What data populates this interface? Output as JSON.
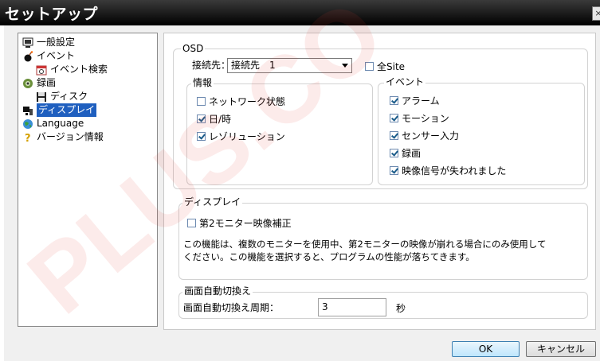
{
  "window": {
    "title": "セットアップ",
    "close_glyph": "×"
  },
  "tree": {
    "items": [
      {
        "label": "一般設定",
        "icon": "monitor-icon",
        "selected": false
      },
      {
        "label": "イベント",
        "icon": "bomb-icon",
        "selected": false
      },
      {
        "label": "イベント検索",
        "icon": "calendar-search-icon",
        "selected": false
      },
      {
        "label": "録画",
        "icon": "camera-icon",
        "selected": false
      },
      {
        "label": "ディスク",
        "icon": "floppy-disk-icon",
        "selected": false
      },
      {
        "label": "ディスプレイ",
        "icon": "display-icon",
        "selected": true
      },
      {
        "label": "Language",
        "icon": "globe-icon",
        "selected": false
      },
      {
        "label": "バージョン情報",
        "icon": "question-mark-icon",
        "selected": false
      }
    ]
  },
  "osd": {
    "label": "OSD",
    "connection_label": "接続先：",
    "connection_value": "接続先　1",
    "all_site_label": "全Site",
    "all_site_checked": false,
    "info": {
      "label": "情報",
      "items": [
        {
          "label": "ネットワーク状態",
          "checked": false
        },
        {
          "label": "日/時",
          "checked": true
        },
        {
          "label": "レゾリューション",
          "checked": true
        }
      ]
    },
    "event": {
      "label": "イベント",
      "items": [
        {
          "label": "アラーム",
          "checked": true
        },
        {
          "label": "モーション",
          "checked": true
        },
        {
          "label": "センサー入力",
          "checked": true
        },
        {
          "label": "録画",
          "checked": true
        },
        {
          "label": "映像信号が失われました",
          "checked": true
        }
      ]
    }
  },
  "display": {
    "label": "ディスプレイ",
    "second_monitor_label": "第2モニター映像補正",
    "second_monitor_checked": false,
    "description_line1": "この機能は、複数のモニターを使用中、第2モニターの映像が崩れる場合にのみ使用して",
    "description_line2": "ください。この機能を選択すると、プログラムの性能が落ちてきます。"
  },
  "auto_switch": {
    "label": "画面自動切換え",
    "period_label": "画面自動切換え周期：",
    "period_value": "3",
    "unit": "秒"
  },
  "buttons": {
    "ok": "OK",
    "cancel": "キャンセル"
  },
  "watermark": {
    "text": "PLUS.CO"
  },
  "colors": {
    "selection": "#1f5fbf",
    "titlebar": "#1a1a1a"
  }
}
